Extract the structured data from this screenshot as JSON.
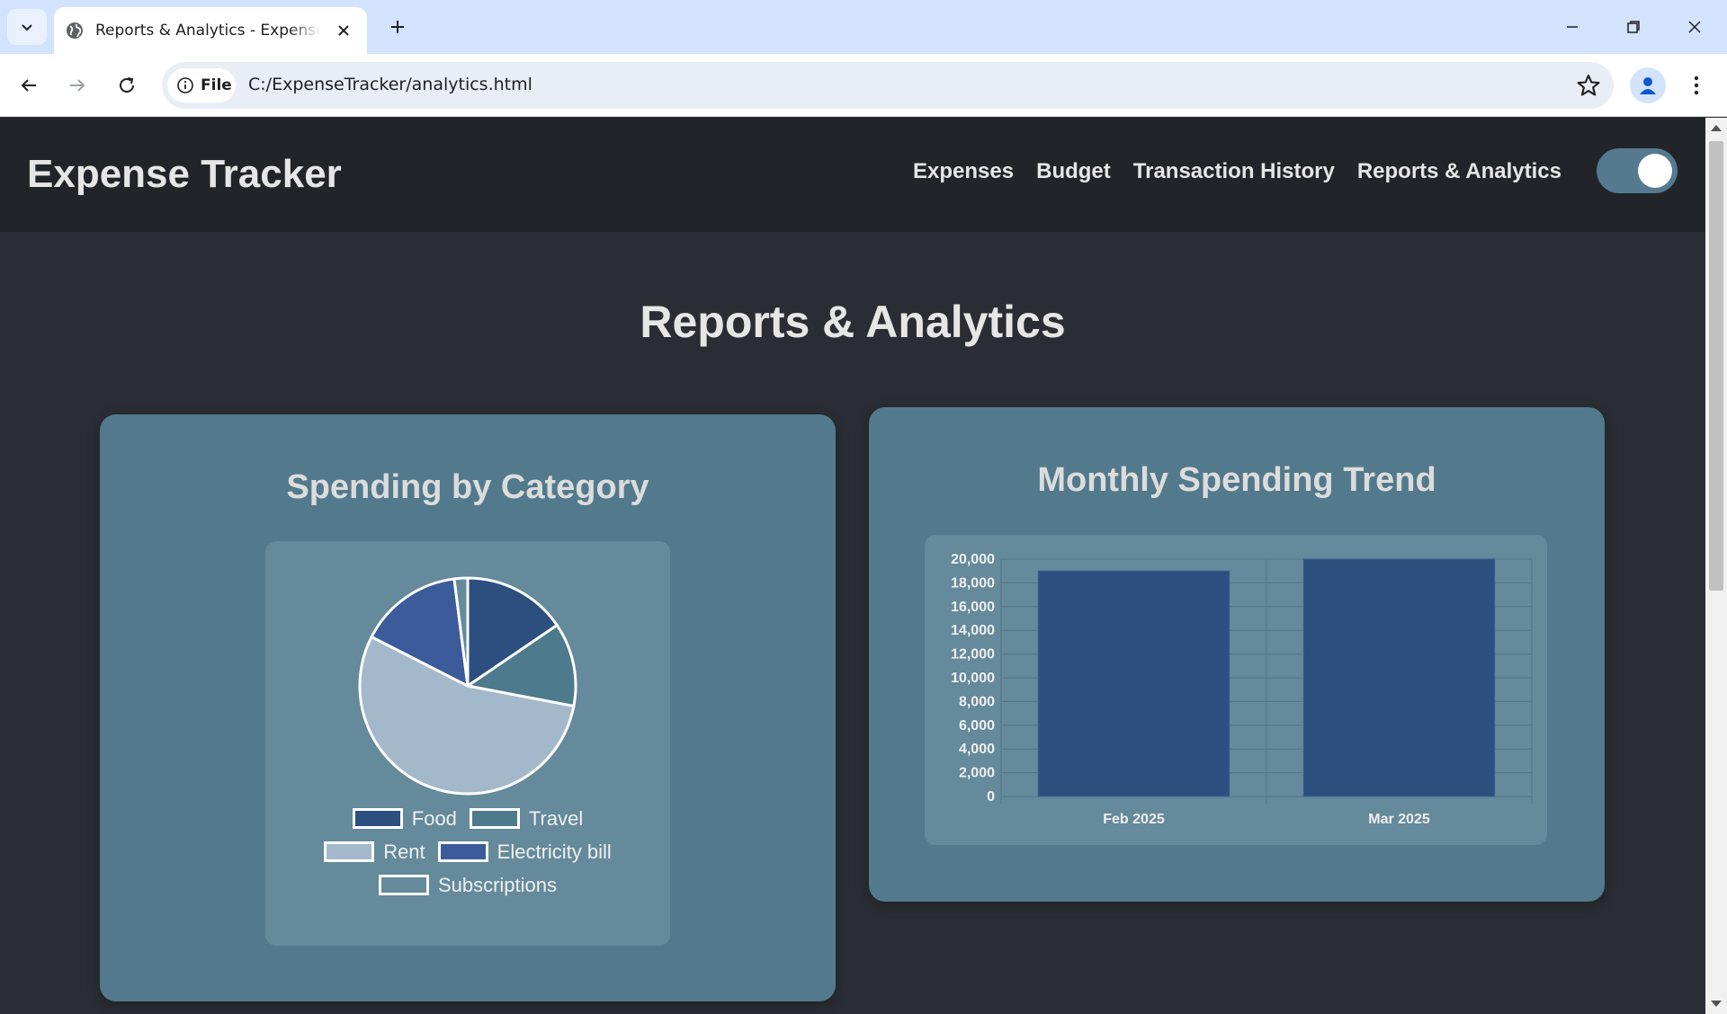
{
  "browser": {
    "tab_title": "Reports & Analytics - Expense Tracker",
    "address_chip": "File",
    "url": "C:/ExpenseTracker/analytics.html"
  },
  "app": {
    "brand": "Expense Tracker",
    "nav": [
      "Expenses",
      "Budget",
      "Transaction History",
      "Reports & Analytics"
    ],
    "page_title": "Reports & Analytics",
    "theme_toggle_on": true
  },
  "colors": {
    "header_bg": "#212529",
    "page_bg": "#2a2d33",
    "card_bg": "#527a8c",
    "accent_dark_blue": "#2c4f7f"
  },
  "cards": {
    "category_title": "Spending by Category",
    "trend_title": "Monthly Spending Trend"
  },
  "chart_data": [
    {
      "type": "pie",
      "title": "Spending by Category",
      "categories": [
        "Food",
        "Travel",
        "Rent",
        "Electricity bill",
        "Subscriptions"
      ],
      "values": [
        15.5,
        12.5,
        54.5,
        15.5,
        2
      ],
      "colors": [
        "#2c4f7f",
        "#4d7a8c",
        "#a3b9cb",
        "#3c5b9b",
        "#648a9b"
      ],
      "legend": "bottom"
    },
    {
      "type": "bar",
      "title": "Monthly Spending Trend",
      "categories": [
        "Feb 2025",
        "Mar 2025"
      ],
      "values": [
        19000,
        20000
      ],
      "y_ticks": [
        "20,000",
        "18,000",
        "16,000",
        "14,000",
        "12,000",
        "10,000",
        "8,000",
        "6,000",
        "4,000",
        "2,000",
        "0"
      ],
      "ylim": [
        0,
        20000
      ],
      "grid": true,
      "bar_color": "#2c4f7f"
    }
  ]
}
